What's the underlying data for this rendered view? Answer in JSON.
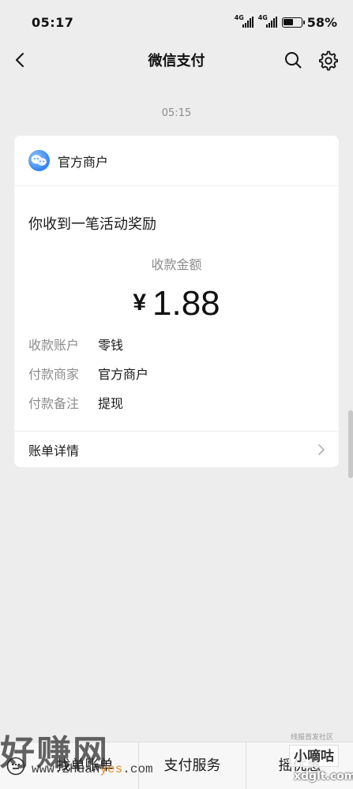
{
  "status_bar": {
    "time": "05:17",
    "network_1": "4G",
    "network_2": "4G",
    "battery_percent": "58%",
    "battery_level": 0.58
  },
  "nav": {
    "title": "微信支付",
    "back_icon": "chevron-left-icon",
    "search_icon": "search-icon",
    "settings_icon": "gear-icon"
  },
  "message": {
    "timestamp": "05:15",
    "merchant_name": "官方商户",
    "title": "你收到一笔活动奖励",
    "amount_label": "收款金额",
    "currency_symbol": "¥",
    "amount": "1.88",
    "details": [
      {
        "key": "收款账户",
        "value": "零钱"
      },
      {
        "key": "付款商家",
        "value": "官方商户"
      },
      {
        "key": "付款备注",
        "value": "提现"
      }
    ],
    "bill_detail_label": "账单详情"
  },
  "bottom_bar": {
    "tabs": [
      "找单账单",
      "支付服务",
      "摇优惠"
    ]
  },
  "watermarks": {
    "left_big": "好赚网",
    "left_url_pre": "www.zhuan",
    "left_url_hl": "yes",
    "left_url_post": ".com",
    "right_tag": "线报首发社区",
    "right_box": "小嘀咕",
    "right_url": "xdglt.com"
  }
}
